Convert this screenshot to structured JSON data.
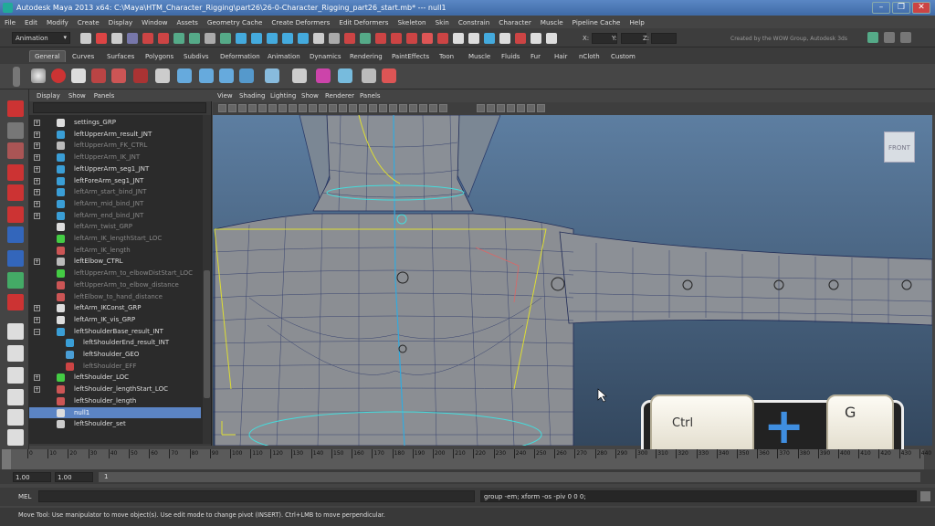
{
  "window": {
    "title": "Autodesk Maya 2013 x64: C:\\Maya\\HTM_Character_Rigging\\part26\\26-0-Character_Rigging_part26_start.mb*   ---   null1",
    "minimize": "–",
    "maximize": "❐",
    "close": "✕"
  },
  "menu": [
    "File",
    "Edit",
    "Modify",
    "Create",
    "Display",
    "Window",
    "Assets",
    "Geometry Cache",
    "Create Deformers",
    "Edit Deformers",
    "Skeleton",
    "Skin",
    "Constrain",
    "Character",
    "Muscle",
    "Pipeline Cache",
    "Help"
  ],
  "status_line": {
    "mode": "Animation",
    "x_label": "X:",
    "y_label": "Y:",
    "z_label": "Z:",
    "credit": "Created by the WOW Group, Autodesk 3ds"
  },
  "shelf_tabs": [
    "General",
    "Curves",
    "Surfaces",
    "Polygons",
    "Subdivs",
    "Deformation",
    "Animation",
    "Dynamics",
    "Rendering",
    "PaintEffects",
    "Toon",
    "Muscle",
    "Fluids",
    "Fur",
    "Hair",
    "nCloth",
    "Custom"
  ],
  "outliner": {
    "menu": [
      "Display",
      "Show",
      "Panels"
    ],
    "rows": [
      {
        "label": "settings_GRP",
        "icon": "transform-icon",
        "expand": "+",
        "dim": false,
        "indent": 0
      },
      {
        "label": "leftUpperArm_result_JNT",
        "icon": "joint-icon",
        "expand": "+",
        "dim": false,
        "indent": 0
      },
      {
        "label": "leftUpperArm_FK_CTRL",
        "icon": "curve-icon",
        "expand": "+",
        "dim": true,
        "indent": 0
      },
      {
        "label": "leftUpperArm_IK_JNT",
        "icon": "joint-icon",
        "expand": "+",
        "dim": true,
        "indent": 0
      },
      {
        "label": "leftUpperArm_seg1_JNT",
        "icon": "joint-icon",
        "expand": "+",
        "dim": false,
        "indent": 0
      },
      {
        "label": "leftForeArm_seg1_JNT",
        "icon": "joint-icon",
        "expand": "+",
        "dim": false,
        "indent": 0
      },
      {
        "label": "leftArm_start_bind_JNT",
        "icon": "joint-icon",
        "expand": "+",
        "dim": true,
        "indent": 0
      },
      {
        "label": "leftArm_mid_bind_JNT",
        "icon": "joint-icon",
        "expand": "+",
        "dim": true,
        "indent": 0
      },
      {
        "label": "leftArm_end_bind_JNT",
        "icon": "joint-icon",
        "expand": "+",
        "dim": true,
        "indent": 0
      },
      {
        "label": "leftArm_twist_GRP",
        "icon": "transform-icon",
        "expand": "",
        "dim": true,
        "indent": 0
      },
      {
        "label": "leftArm_IK_lengthStart_LOC",
        "icon": "locator-icon",
        "expand": "",
        "dim": true,
        "indent": 0
      },
      {
        "label": "leftArm_IK_length",
        "icon": "distance-icon",
        "expand": "",
        "dim": true,
        "indent": 0
      },
      {
        "label": "leftElbow_CTRL",
        "icon": "curve-icon",
        "expand": "+",
        "dim": false,
        "indent": 0
      },
      {
        "label": "leftUpperArm_to_elbowDistStart_LOC",
        "icon": "locator-icon",
        "expand": "",
        "dim": true,
        "indent": 0
      },
      {
        "label": "leftUpperArm_to_elbow_distance",
        "icon": "distance-icon",
        "expand": "",
        "dim": true,
        "indent": 0
      },
      {
        "label": "leftElbow_to_hand_distance",
        "icon": "distance-icon",
        "expand": "",
        "dim": true,
        "indent": 0
      },
      {
        "label": "leftArm_IKConst_GRP",
        "icon": "transform-icon",
        "expand": "+",
        "dim": false,
        "indent": 0
      },
      {
        "label": "leftArm_IK_vis_GRP",
        "icon": "transform-icon",
        "expand": "+",
        "dim": false,
        "indent": 0
      },
      {
        "label": "leftShoulderBase_result_INT",
        "icon": "joint-icon",
        "expand": "−",
        "dim": false,
        "indent": 0
      },
      {
        "label": "leftShoulderEnd_result_INT",
        "icon": "joint-icon",
        "expand": "",
        "dim": false,
        "indent": 1
      },
      {
        "label": "leftShoulder_GEO",
        "icon": "mesh-icon",
        "expand": "",
        "dim": false,
        "indent": 1
      },
      {
        "label": "leftShoulder_EFF",
        "icon": "effector-icon",
        "expand": "",
        "dim": true,
        "indent": 1
      },
      {
        "label": "leftShoulder_LOC",
        "icon": "locator-icon",
        "expand": "+",
        "dim": false,
        "indent": 0
      },
      {
        "label": "leftShoulder_lengthStart_LOC",
        "icon": "distance-icon",
        "expand": "+",
        "dim": false,
        "indent": 0
      },
      {
        "label": "leftShoulder_length",
        "icon": "distance-icon",
        "expand": "",
        "dim": false,
        "indent": 0
      },
      {
        "label": "null1",
        "icon": "transform-icon",
        "expand": "",
        "dim": false,
        "indent": 0,
        "selected": true
      },
      {
        "label": "leftShoulder_set",
        "icon": "set-icon",
        "expand": "",
        "dim": false,
        "indent": 0
      }
    ]
  },
  "viewport": {
    "menu": [
      "View",
      "Shading",
      "Lighting",
      "Show",
      "Renderer",
      "Panels"
    ],
    "view_cube": "FRONT"
  },
  "time_slider": {
    "ticks": [
      "0",
      "10",
      "20",
      "30",
      "40",
      "50",
      "60",
      "70",
      "80",
      "90",
      "100",
      "110",
      "120",
      "130",
      "140",
      "150",
      "160",
      "170",
      "180",
      "190",
      "200",
      "210",
      "220",
      "230",
      "240",
      "250",
      "260",
      "270",
      "280",
      "290",
      "300",
      "310",
      "320",
      "330",
      "340",
      "350",
      "360",
      "370",
      "380",
      "390",
      "400",
      "410",
      "420",
      "430",
      "440"
    ],
    "range_start": "1.00",
    "range_start2": "1.00",
    "current": "1"
  },
  "command_line": {
    "label": "MEL",
    "result": "group -em; xform -os -piv 0 0 0;"
  },
  "help_line": "Move Tool: Use manipulator to move object(s). Use edit mode to change pivot (INSERT).  Ctrl+LMB to move perpendicular.",
  "keys_overlay": {
    "key1": "Ctrl",
    "plus": "+",
    "key2": "G"
  }
}
